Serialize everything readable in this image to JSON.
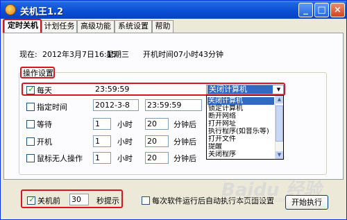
{
  "window": {
    "title": "关机王1.2",
    "buttons": {
      "minimize": "_",
      "maximize": "□",
      "close": "×"
    }
  },
  "tabs": [
    {
      "label": "定时关机",
      "active": true
    },
    {
      "label": "计划任务"
    },
    {
      "label": "高级功能"
    },
    {
      "label": "系统设置"
    },
    {
      "label": "帮助"
    }
  ],
  "status": {
    "now_label": "现在:",
    "date": "2012年3月7日16:15",
    "weekday": "星期三",
    "uptime": "开机时间07小时43分钟"
  },
  "group": {
    "title": "操作设置",
    "rows": {
      "daily": {
        "label": "每天",
        "checked": true,
        "time": "23:59:59"
      },
      "specific": {
        "label": "指定时间",
        "checked": false,
        "date": "2012-3-8",
        "time": "23:59:59"
      },
      "wait": {
        "label": "等待",
        "checked": false,
        "hours": "1",
        "hours_unit": "小时",
        "minutes": "20",
        "minutes_unit": "分钟后"
      },
      "boot": {
        "label": "开机",
        "checked": false,
        "hours": "1",
        "hours_unit": "小时",
        "minutes": "20",
        "minutes_unit": "分钟后"
      },
      "idle": {
        "label": "鼠标无人操作",
        "checked": false,
        "hours": "1",
        "hours_unit": "小时",
        "minutes": "20",
        "minutes_unit": "分钟后"
      }
    },
    "action": {
      "selected": "关闭计算机",
      "options": [
        "关闭计算机",
        "锁定计算机",
        "断开网络",
        "打开网址",
        "执行程序(如音乐等)",
        "打开文件",
        "提醒",
        "关闭程序"
      ]
    }
  },
  "bottom": {
    "before_label": "关机前",
    "before_checked": true,
    "before_value": "30",
    "before_unit": "秒提示",
    "auto_checked": false,
    "auto_label": "每次软件运行后自动执行本页面设置",
    "start_button": "开始执行"
  },
  "watermark": {
    "text": "Baidu 经验",
    "url": "jingyan.baidu.com"
  },
  "colors": {
    "title_bar": "#0a50d6",
    "highlight": "#d8141e",
    "selection": "#316ac5",
    "check": "#21a121"
  }
}
